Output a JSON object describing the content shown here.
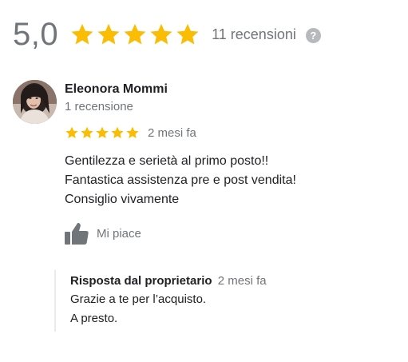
{
  "summary": {
    "rating": "5,0",
    "stars": 5,
    "review_count": "11 recensioni",
    "help_symbol": "?",
    "star_color": "#fbbc04"
  },
  "review": {
    "author": "Eleonora Mommi",
    "author_meta": "1 recensione",
    "stars": 5,
    "date": "2 mesi fa",
    "text_lines": [
      "Gentilezza e serietà al primo posto!!",
      "Fantastica assistenza pre e post vendita!",
      "Consiglio vivamente"
    ],
    "like_label": "Mi piace",
    "icons": {
      "avatar": "avatar",
      "like": "thumbs-up-icon"
    }
  },
  "owner_response": {
    "title": "Risposta dal proprietario",
    "date": "2 mesi fa",
    "text_lines": [
      "Grazie a te per l’acquisto.",
      "A presto."
    ]
  }
}
